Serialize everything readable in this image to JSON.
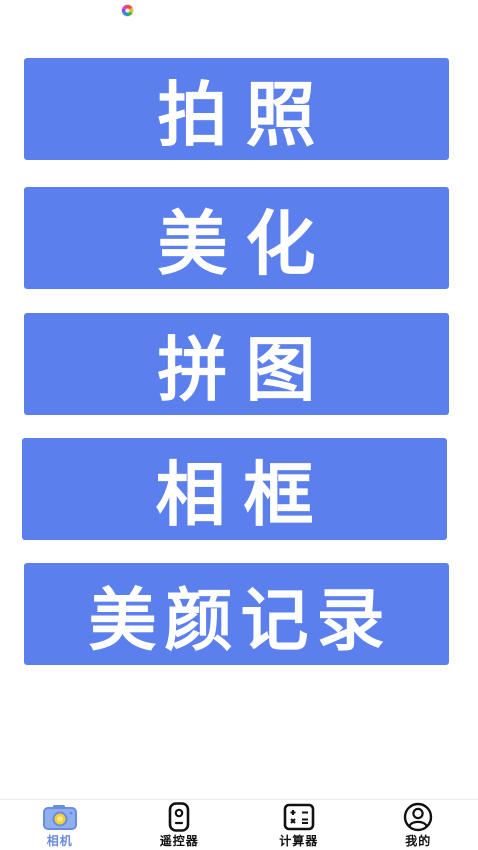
{
  "theme": {
    "button_bg": "#5b80ee",
    "button_text": "#ffffff",
    "tab_active": "#6b8bdc",
    "tab_inactive": "#111111"
  },
  "status_bar": {
    "app_icon": "colorful-pinwheel-icon"
  },
  "menu": {
    "items": [
      {
        "label": "拍照"
      },
      {
        "label": "美化"
      },
      {
        "label": "拼图"
      },
      {
        "label": "相框"
      },
      {
        "label": "美颜记录"
      }
    ]
  },
  "tabbar": {
    "tabs": [
      {
        "label": "相机",
        "icon": "camera-icon",
        "active": true
      },
      {
        "label": "遥控器",
        "icon": "remote-control-icon",
        "active": false
      },
      {
        "label": "计算器",
        "icon": "calculator-icon",
        "active": false
      },
      {
        "label": "我的",
        "icon": "user-profile-icon",
        "active": false
      }
    ]
  }
}
